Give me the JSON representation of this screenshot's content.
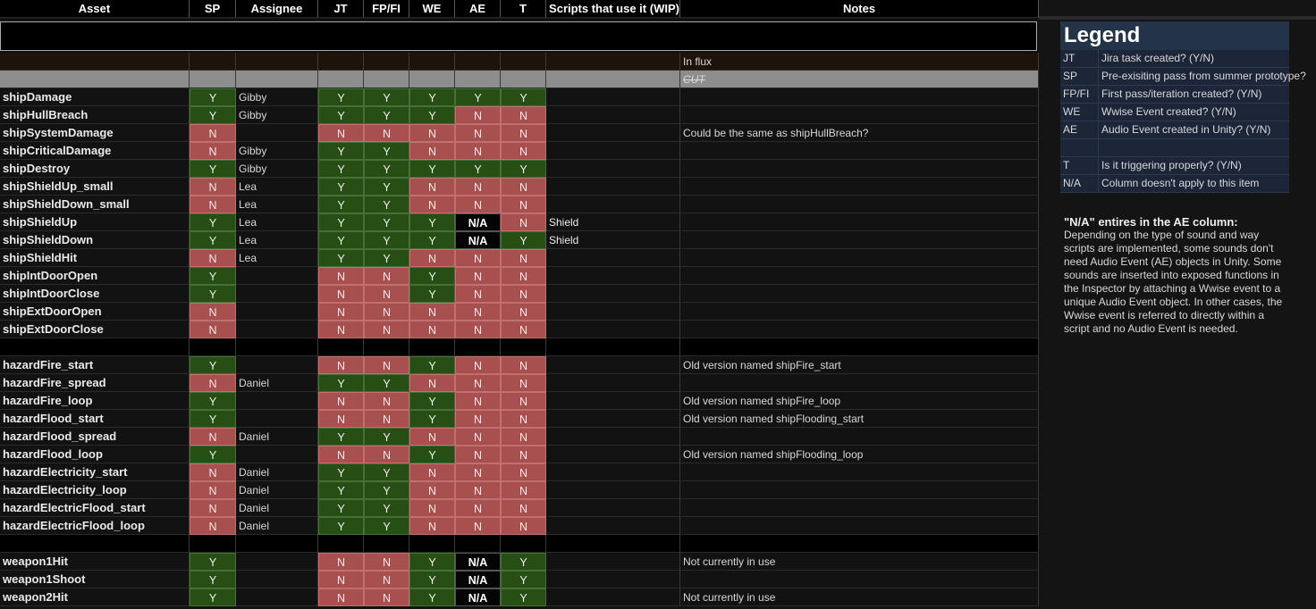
{
  "headers": {
    "asset": "Asset",
    "sp": "SP",
    "assignee": "Assignee",
    "jt": "JT",
    "fpfi": "FP/FI",
    "we": "WE",
    "ae": "AE",
    "t": "T",
    "scripts": "Scripts that use it (WIP)",
    "notes": "Notes"
  },
  "status_rows": [
    {
      "note": "In flux"
    },
    {
      "note": "CUT"
    }
  ],
  "rows": [
    {
      "asset": "shipDamage",
      "sp": "Y",
      "assignee": "Gibby",
      "jt": "Y",
      "fp": "Y",
      "we": "Y",
      "ae": "Y",
      "t": "Y",
      "scripts": "",
      "notes": ""
    },
    {
      "asset": "shipHullBreach",
      "sp": "Y",
      "assignee": "Gibby",
      "jt": "Y",
      "fp": "Y",
      "we": "Y",
      "ae": "N",
      "t": "N",
      "scripts": "",
      "notes": ""
    },
    {
      "asset": "shipSystemDamage",
      "sp": "N",
      "assignee": "",
      "jt": "N",
      "fp": "N",
      "we": "N",
      "ae": "N",
      "t": "N",
      "scripts": "",
      "notes": "Could be the same as shipHullBreach?"
    },
    {
      "asset": "shipCriticalDamage",
      "sp": "N",
      "assignee": "Gibby",
      "jt": "Y",
      "fp": "Y",
      "we": "N",
      "ae": "N",
      "t": "N",
      "scripts": "",
      "notes": ""
    },
    {
      "asset": "shipDestroy",
      "sp": "Y",
      "assignee": "Gibby",
      "jt": "Y",
      "fp": "Y",
      "we": "Y",
      "ae": "Y",
      "t": "Y",
      "scripts": "",
      "notes": ""
    },
    {
      "asset": "shipShieldUp_small",
      "sp": "N",
      "assignee": "Lea",
      "jt": "Y",
      "fp": "Y",
      "we": "N",
      "ae": "N",
      "t": "N",
      "scripts": "",
      "notes": ""
    },
    {
      "asset": "shipShieldDown_small",
      "sp": "N",
      "assignee": "Lea",
      "jt": "Y",
      "fp": "Y",
      "we": "N",
      "ae": "N",
      "t": "N",
      "scripts": "",
      "notes": ""
    },
    {
      "asset": "shipShieldUp",
      "sp": "Y",
      "assignee": "Lea",
      "jt": "Y",
      "fp": "Y",
      "we": "Y",
      "ae": "N/A",
      "t": "N",
      "scripts": "Shield",
      "notes": ""
    },
    {
      "asset": "shipShieldDown",
      "sp": "Y",
      "assignee": "Lea",
      "jt": "Y",
      "fp": "Y",
      "we": "Y",
      "ae": "N/A",
      "t": "Y",
      "scripts": "Shield",
      "notes": ""
    },
    {
      "asset": "shipShieldHit",
      "sp": "N",
      "assignee": "Lea",
      "jt": "Y",
      "fp": "Y",
      "we": "N",
      "ae": "N",
      "t": "N",
      "scripts": "",
      "notes": ""
    },
    {
      "asset": "shipIntDoorOpen",
      "sp": "Y",
      "assignee": "",
      "jt": "N",
      "fp": "N",
      "we": "Y",
      "ae": "N",
      "t": "N",
      "scripts": "",
      "notes": ""
    },
    {
      "asset": "shipIntDoorClose",
      "sp": "Y",
      "assignee": "",
      "jt": "N",
      "fp": "N",
      "we": "Y",
      "ae": "N",
      "t": "N",
      "scripts": "",
      "notes": ""
    },
    {
      "asset": "shipExtDoorOpen",
      "sp": "N",
      "assignee": "",
      "jt": "N",
      "fp": "N",
      "we": "N",
      "ae": "N",
      "t": "N",
      "scripts": "",
      "notes": ""
    },
    {
      "asset": "shipExtDoorClose",
      "sp": "N",
      "assignee": "",
      "jt": "N",
      "fp": "N",
      "we": "N",
      "ae": "N",
      "t": "N",
      "scripts": "",
      "notes": ""
    },
    {
      "spacer": true
    },
    {
      "asset": "hazardFire_start",
      "sp": "Y",
      "assignee": "",
      "jt": "N",
      "fp": "N",
      "we": "Y",
      "ae": "N",
      "t": "N",
      "scripts": "",
      "notes": "Old version named shipFire_start"
    },
    {
      "asset": "hazardFire_spread",
      "sp": "N",
      "assignee": "Daniel",
      "jt": "Y",
      "fp": "Y",
      "we": "N",
      "ae": "N",
      "t": "N",
      "scripts": "",
      "notes": ""
    },
    {
      "asset": "hazardFire_loop",
      "sp": "Y",
      "assignee": "",
      "jt": "N",
      "fp": "N",
      "we": "Y",
      "ae": "N",
      "t": "N",
      "scripts": "",
      "notes": "Old version named shipFire_loop"
    },
    {
      "asset": "hazardFlood_start",
      "sp": "Y",
      "assignee": "",
      "jt": "N",
      "fp": "N",
      "we": "Y",
      "ae": "N",
      "t": "N",
      "scripts": "",
      "notes": "Old version named shipFlooding_start"
    },
    {
      "asset": "hazardFlood_spread",
      "sp": "N",
      "assignee": "Daniel",
      "jt": "Y",
      "fp": "Y",
      "we": "N",
      "ae": "N",
      "t": "N",
      "scripts": "",
      "notes": ""
    },
    {
      "asset": "hazardFlood_loop",
      "sp": "Y",
      "assignee": "",
      "jt": "N",
      "fp": "N",
      "we": "Y",
      "ae": "N",
      "t": "N",
      "scripts": "",
      "notes": "Old version named shipFlooding_loop"
    },
    {
      "asset": "hazardElectricity_start",
      "sp": "N",
      "assignee": "Daniel",
      "jt": "Y",
      "fp": "Y",
      "we": "N",
      "ae": "N",
      "t": "N",
      "scripts": "",
      "notes": ""
    },
    {
      "asset": "hazardElectricity_loop",
      "sp": "N",
      "assignee": "Daniel",
      "jt": "Y",
      "fp": "Y",
      "we": "N",
      "ae": "N",
      "t": "N",
      "scripts": "",
      "notes": ""
    },
    {
      "asset": "hazardElectricFlood_start",
      "sp": "N",
      "assignee": "Daniel",
      "jt": "Y",
      "fp": "Y",
      "we": "N",
      "ae": "N",
      "t": "N",
      "scripts": "",
      "notes": ""
    },
    {
      "asset": "hazardElectricFlood_loop",
      "sp": "N",
      "assignee": "Daniel",
      "jt": "Y",
      "fp": "Y",
      "we": "N",
      "ae": "N",
      "t": "N",
      "scripts": "",
      "notes": ""
    },
    {
      "spacer": true
    },
    {
      "asset": "weapon1Hit",
      "sp": "Y",
      "assignee": "",
      "jt": "N",
      "fp": "N",
      "we": "Y",
      "ae": "N/A",
      "t": "Y",
      "scripts": "",
      "notes": "Not currently in use"
    },
    {
      "asset": "weapon1Shoot",
      "sp": "Y",
      "assignee": "",
      "jt": "N",
      "fp": "N",
      "we": "Y",
      "ae": "N/A",
      "t": "Y",
      "scripts": "",
      "notes": ""
    },
    {
      "asset": "weapon2Hit",
      "sp": "Y",
      "assignee": "",
      "jt": "N",
      "fp": "N",
      "we": "Y",
      "ae": "N/A",
      "t": "Y",
      "scripts": "",
      "notes": "Not currently in use"
    }
  ],
  "legend": {
    "title": "Legend",
    "items": [
      {
        "key": "JT",
        "desc": "Jira task created? (Y/N)"
      },
      {
        "key": "SP",
        "desc": "Pre-exisiting pass from summer prototype?"
      },
      {
        "key": "FP/FI",
        "desc": "First pass/iteration created? (Y/N)"
      },
      {
        "key": "WE",
        "desc": "Wwise Event created? (Y/N)"
      },
      {
        "key": "AE",
        "desc": "Audio Event created in Unity? (Y/N)"
      },
      {
        "key": "",
        "desc": ""
      },
      {
        "key": "T",
        "desc": "Is it triggering properly? (Y/N)"
      },
      {
        "key": "N/A",
        "desc": "Column doesn't apply to this item"
      }
    ]
  },
  "na_note": {
    "title": "\"N/A\" entires in the AE column:",
    "body": "Depending on the type of sound and way scripts are implemented, some sounds don't need Audio Event (AE) objects in Unity. Some sounds are inserted into exposed functions in the Inspector by attaching a Wwise event to a unique Audio Event object. In other cases, the Wwise event is referred to directly within a script and no Audio Event is needed."
  },
  "colors": {
    "yes": "#274e13",
    "no": "#a85050",
    "na": "#050505",
    "legend_bg": "#1c2638"
  }
}
